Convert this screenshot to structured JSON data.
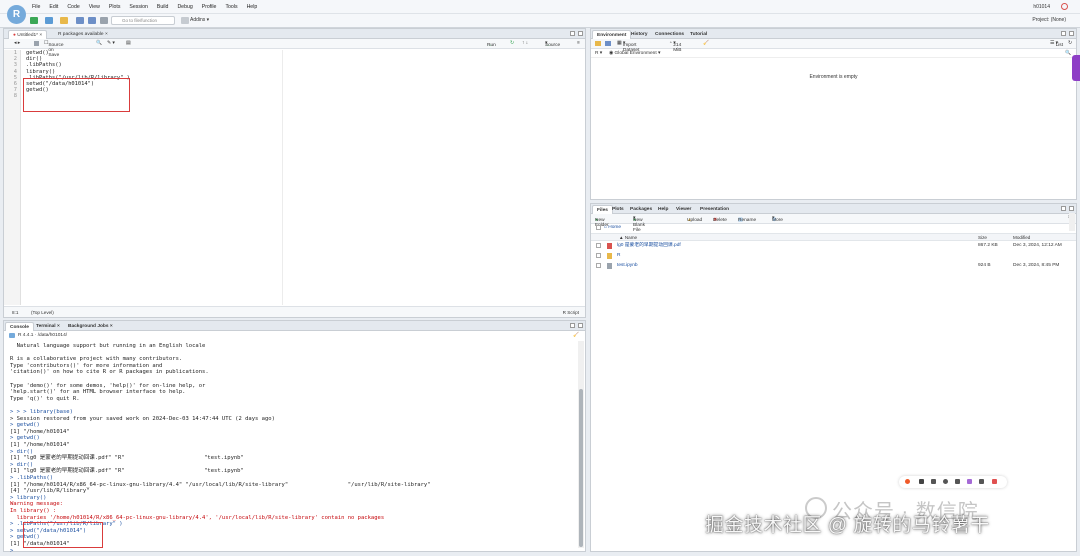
{
  "app": {
    "logo_letter": "R",
    "menu": [
      "File",
      "Edit",
      "Code",
      "View",
      "Plots",
      "Session",
      "Build",
      "Debug",
      "Profile",
      "Tools",
      "Help"
    ],
    "user": "h01014",
    "project": "Project: (None)"
  },
  "toolbar": {
    "goto_placeholder": "Go to file/function",
    "addins": "Addins"
  },
  "editor": {
    "tabs": [
      "Untitled1*",
      "R packages available"
    ],
    "source_on_save": "Source on Save",
    "run": "Run",
    "source": "Source",
    "lines": [
      {
        "n": "1",
        "text": "getwd()"
      },
      {
        "n": "2",
        "text": "dir()"
      },
      {
        "n": "3",
        "text": ".libPaths()"
      },
      {
        "n": "4",
        "text": "library()"
      },
      {
        "n": "5",
        "text": ".libPaths(\"/usr/lib/R/library\" )"
      },
      {
        "n": "6",
        "text": "setwd(\"/data/h01014\")"
      },
      {
        "n": "7",
        "text": "getwd()"
      },
      {
        "n": "8",
        "text": ""
      }
    ],
    "status_pos": "8:1",
    "status_scope": "(Top Level)",
    "status_lang": "R Script"
  },
  "console": {
    "tabs": [
      "Console",
      "Terminal",
      "Background Jobs"
    ],
    "r_version": "R 4.4.1 · /data/h01014/",
    "lines": [
      {
        "cls": "",
        "text": "  Natural language support but running in an English locale"
      },
      {
        "cls": "",
        "text": ""
      },
      {
        "cls": "",
        "text": "R is a collaborative project with many contributors."
      },
      {
        "cls": "",
        "text": "Type 'contributors()' for more information and"
      },
      {
        "cls": "",
        "text": "'citation()' on how to cite R or R packages in publications."
      },
      {
        "cls": "",
        "text": ""
      },
      {
        "cls": "",
        "text": "Type 'demo()' for some demos, 'help()' for on-line help, or"
      },
      {
        "cls": "",
        "text": "'help.start()' for an HTML browser interface to help."
      },
      {
        "cls": "",
        "text": "Type 'q()' to quit R."
      },
      {
        "cls": "",
        "text": ""
      },
      {
        "cls": "prompt",
        "text": "> > > library(base)"
      },
      {
        "cls": "",
        "text": "> Session restored from your saved work on 2024-Dec-03 14:47:44 UTC (2 days ago)"
      },
      {
        "cls": "prompt",
        "text": "> getwd()"
      },
      {
        "cls": "",
        "text": "[1] \"/home/h01014\""
      },
      {
        "cls": "prompt",
        "text": "> getwd()"
      },
      {
        "cls": "",
        "text": "[1] \"/home/h01014\""
      },
      {
        "cls": "prompt",
        "text": "> dir()"
      },
      {
        "cls": "",
        "text": "[1] \"lg0 是蒙老的早期提动回课.pdf\" \"R\"                        \"test.ipynb\""
      },
      {
        "cls": "prompt",
        "text": "> dir()"
      },
      {
        "cls": "",
        "text": "[1] \"lg0 是蒙老的早期提动回课.pdf\" \"R\"                        \"test.ipynb\""
      },
      {
        "cls": "prompt",
        "text": "> .libPaths()"
      },
      {
        "cls": "",
        "text": "[1] \"/home/h01014/R/x86_64-pc-linux-gnu-library/4.4\" \"/usr/local/lib/R/site-library\"                  \"/usr/lib/R/site-library\""
      },
      {
        "cls": "",
        "text": "[4] \"/usr/lib/R/library\""
      },
      {
        "cls": "prompt",
        "text": "> library()"
      },
      {
        "cls": "warn",
        "text": "Warning message:"
      },
      {
        "cls": "warn",
        "text": "In library() :"
      },
      {
        "cls": "warn",
        "text": "  libraries '/home/h01014/R/x86_64-pc-linux-gnu-library/4.4', '/usr/local/lib/R/site-library' contain no packages"
      },
      {
        "cls": "prompt",
        "text": "> .libPaths(\"/usr/lib/R/library\" )"
      },
      {
        "cls": "prompt",
        "text": "> setwd(\"/data/h01014\")"
      },
      {
        "cls": "prompt",
        "text": "> getwd()"
      },
      {
        "cls": "",
        "text": "[1] \"/data/h01014\""
      },
      {
        "cls": "prompt",
        "text": ">"
      }
    ]
  },
  "environment": {
    "tabs": [
      "Environment",
      "History",
      "Connections",
      "Tutorial"
    ],
    "import_dataset": "Import Dataset",
    "memory": "214 MiB",
    "list_view": "List",
    "r_label": "R",
    "global_env": "Global Environment",
    "empty_msg": "Environment is empty"
  },
  "files": {
    "tabs": [
      "Files",
      "Plots",
      "Packages",
      "Help",
      "Viewer",
      "Presentation"
    ],
    "new_folder": "New Folder",
    "new_blank_file": "New Blank File",
    "upload": "Upload",
    "delete": "Delete",
    "rename": "Rename",
    "more": "More",
    "breadcrumb": "Home",
    "col_name": "Name",
    "col_size": "Size",
    "col_modified": "Modified",
    "rows": [
      {
        "icon": "pdf-icon",
        "name": "lg0 是蒙老的早期提动回课.pdf",
        "size": "867.2 KB",
        "modified": "Dec 3, 2024, 12:12 AM"
      },
      {
        "icon": "folder-icon",
        "name": "R",
        "size": "",
        "modified": ""
      },
      {
        "icon": "notebook-icon",
        "name": "test.ipynb",
        "size": "924 B",
        "modified": "Dec 3, 2024, 8:45 PM"
      }
    ]
  },
  "watermark": {
    "gray_text": "公众号 · 数信院",
    "white_text": "掘金技术社区 @ 旋转的马铃薯干"
  },
  "colors": {
    "red_box": "#d93c3c",
    "r_logo": "#75aadb",
    "link_blue": "#1a4fa0"
  }
}
